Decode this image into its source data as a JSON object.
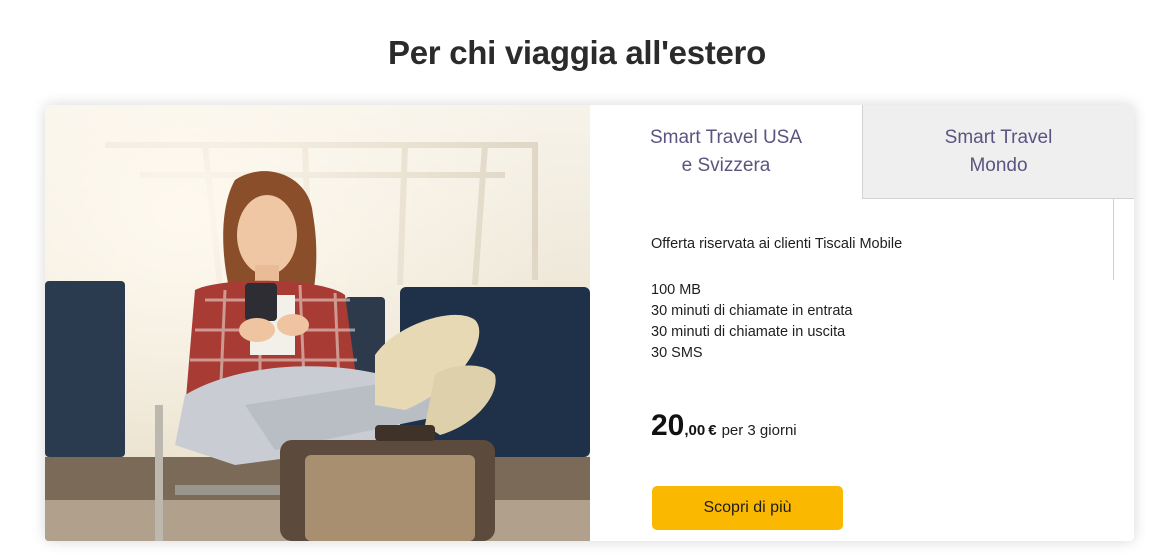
{
  "section": {
    "title": "Per chi viaggia all'estero"
  },
  "tabs": [
    {
      "line1": "Smart Travel USA",
      "line2": "e Svizzera",
      "active": true
    },
    {
      "line1": "Smart Travel",
      "line2": "Mondo",
      "active": false
    }
  ],
  "offer": {
    "note": "Offerta riservata ai clienti Tiscali Mobile",
    "features": [
      "100 MB",
      "30 minuti di chiamate in entrata",
      "30 minuti di chiamate in uscita",
      "30 SMS"
    ],
    "price": {
      "integer": "20",
      "decimal": ",00",
      "currency": "€",
      "period": "per 3 giorni"
    },
    "cta_label": "Scopri di più"
  },
  "colors": {
    "cta": "#fbb800",
    "tab_text": "#5a5580",
    "inactive_tab_bg": "#efefef"
  }
}
